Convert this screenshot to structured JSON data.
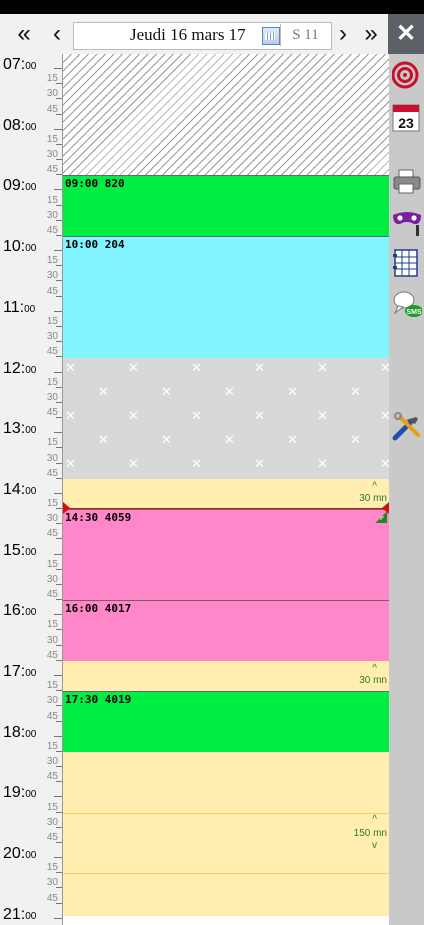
{
  "toolbar": {
    "first_label": "«",
    "prev_label": "‹",
    "date_label": "Jeudi 16 mars 17",
    "week_label": "S 11",
    "next_label": "›",
    "last_label": "»"
  },
  "side": {
    "close_label": "✕",
    "icons": [
      "target-icon",
      "calendar-23-icon",
      "printer-icon",
      "mask-icon",
      "grid-calendar-icon",
      "sms-icon",
      "tools-icon"
    ],
    "calendar_day": "23",
    "sms_text": "SMS"
  },
  "hours": [
    "07:",
    "08:",
    "09:",
    "10:",
    "11:",
    "12:",
    "13:",
    "14:",
    "15:",
    "16:",
    "17:",
    "18:",
    "19:",
    "20:",
    "21:"
  ],
  "minute_suffix": "00",
  "quarters": [
    "15",
    "30",
    "45"
  ],
  "appointments": [
    {
      "title": "09:00  820",
      "color": "#00ee44"
    },
    {
      "title": "10:00  204",
      "color": "#80f4ff"
    },
    {
      "title": "14:30  4059",
      "color": "#ff86c8"
    },
    {
      "title": "16:00  4017",
      "color": "#ff86c8"
    },
    {
      "title": "17:30  4019",
      "color": "#00ee44"
    }
  ],
  "free_slots": [
    {
      "duration": "30 mn"
    },
    {
      "duration": "30 mn"
    },
    {
      "duration": "150 mn"
    }
  ],
  "colors": {
    "unavailable_hatch": "#9a9a9a",
    "lunch_gray": "#d8d8d8",
    "free_yellow": "#ffeeb0",
    "now_red": "#d01010",
    "accent_green": "#2a7a2a"
  }
}
